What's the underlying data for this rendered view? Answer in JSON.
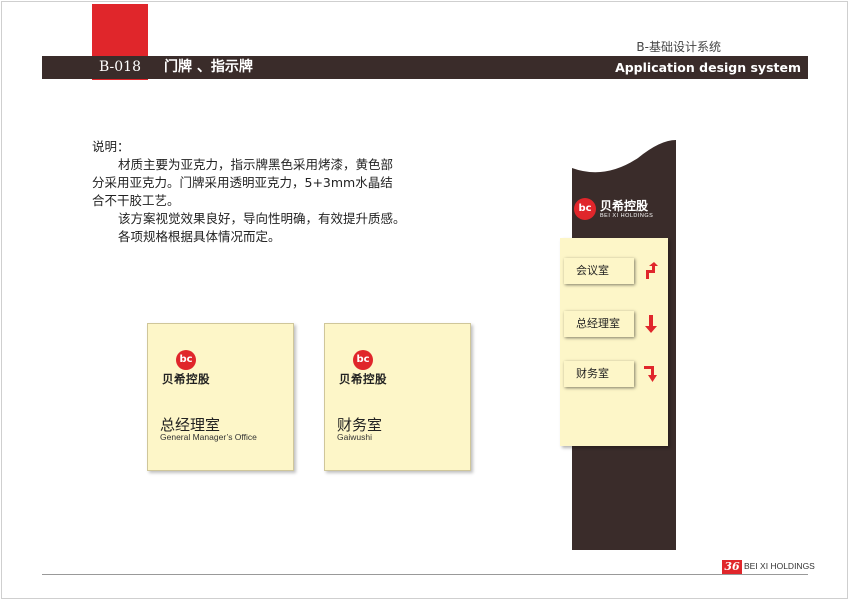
{
  "header": {
    "code": "B-018",
    "title": "门牌 、指示牌",
    "system_cn": "B-基础设计系统",
    "system_en": "Application design system"
  },
  "description": {
    "heading": "说明：",
    "para1_line1": "材质主要为亚克力，指示牌黑色采用烤漆，黄色部",
    "para1_line2": "分采用亚克力。门牌采用透明亚克力，5+3mm水晶结",
    "para1_line3": "合不干胶工艺。",
    "para2": "该方案视觉效果良好，导向性明确，有效提升质感。",
    "para3": "各项规格根据具体情况而定。"
  },
  "logo": {
    "mark": "bc",
    "name_cn": "贝希控股",
    "name_en": "BEI XI HOLDINGS"
  },
  "door_signs": [
    {
      "name": "总经理室",
      "subtitle": "General Manager’s Office"
    },
    {
      "name": "财务室",
      "subtitle": "Gaiwushi"
    }
  ],
  "directory": [
    {
      "label": "会议室",
      "arrow": "up-right"
    },
    {
      "label": "总经理室",
      "arrow": "down"
    },
    {
      "label": "财务室",
      "arrow": "down-right"
    }
  ],
  "colors": {
    "brand_red": "#e0262b",
    "dark_brown": "#3a2c2a",
    "panel_yellow": "#fdf6c8"
  },
  "footer": {
    "page": "36",
    "brand": "BEI XI HOLDINGS"
  }
}
